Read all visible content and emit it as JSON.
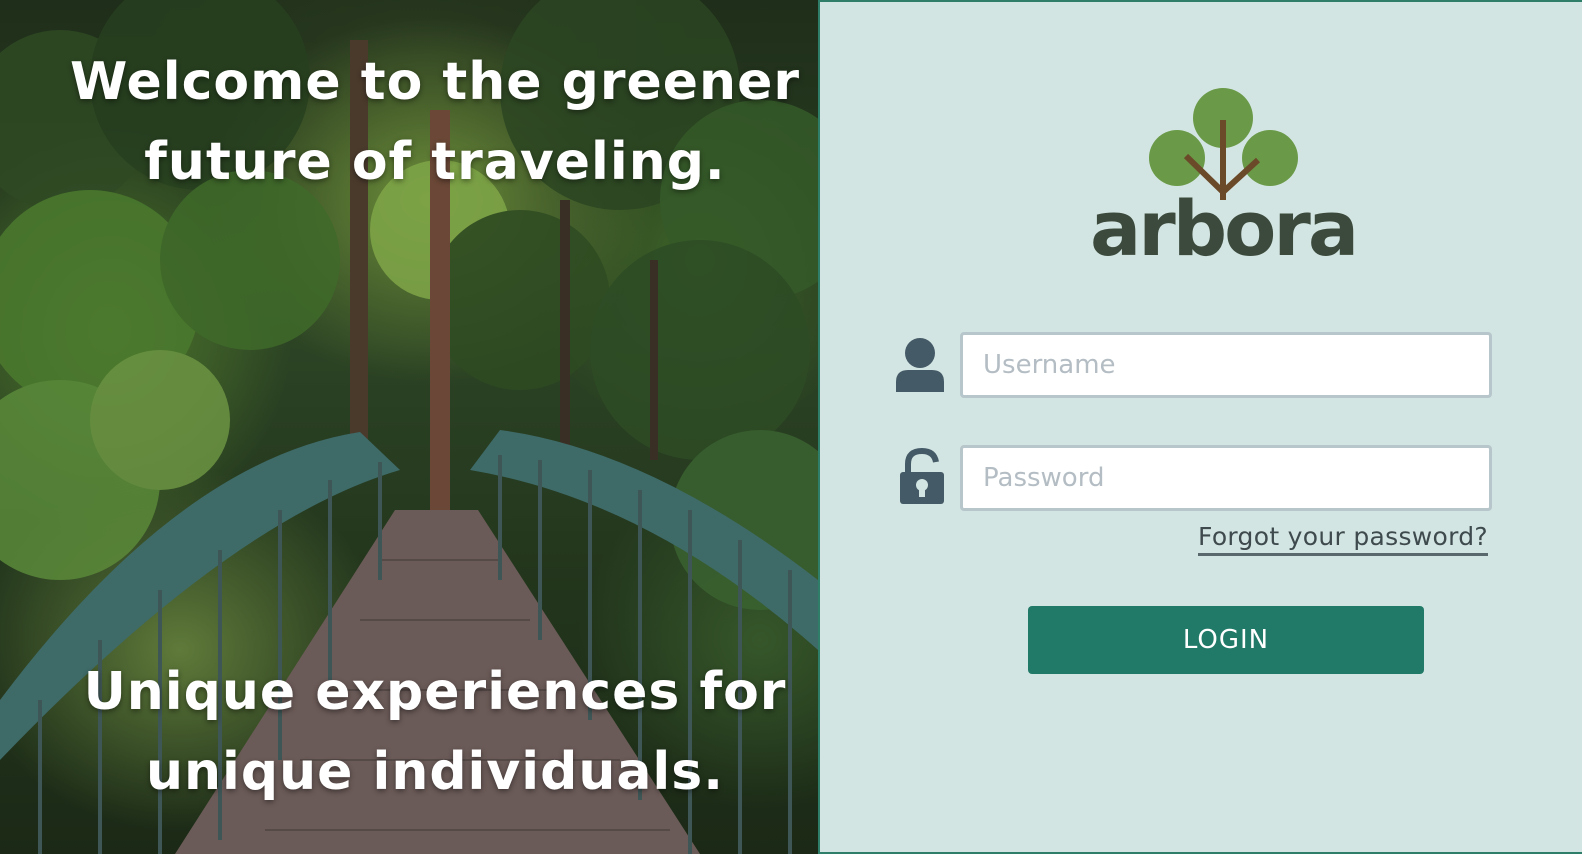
{
  "hero": {
    "headline_line1": "Welcome to the greener",
    "headline_line2": "future of traveling.",
    "tagline_line1": "Unique experiences for",
    "tagline_line2": "unique individuals."
  },
  "brand": {
    "name": "arbora",
    "icon": "tree-logo-icon",
    "colors": {
      "leaf": "#6a9a48",
      "trunk": "#6b4a2a",
      "wordmark": "#3b4a3c"
    }
  },
  "form": {
    "username": {
      "icon": "user-icon",
      "value": "",
      "placeholder": "Username"
    },
    "password": {
      "icon": "lock-icon",
      "value": "",
      "placeholder": "Password"
    },
    "forgot_label": "Forgot your password?",
    "login_label": "LOGIN"
  },
  "colors": {
    "panel_bg": "#d3e5e2",
    "accent": "#217a68",
    "icon": "#445a67"
  }
}
